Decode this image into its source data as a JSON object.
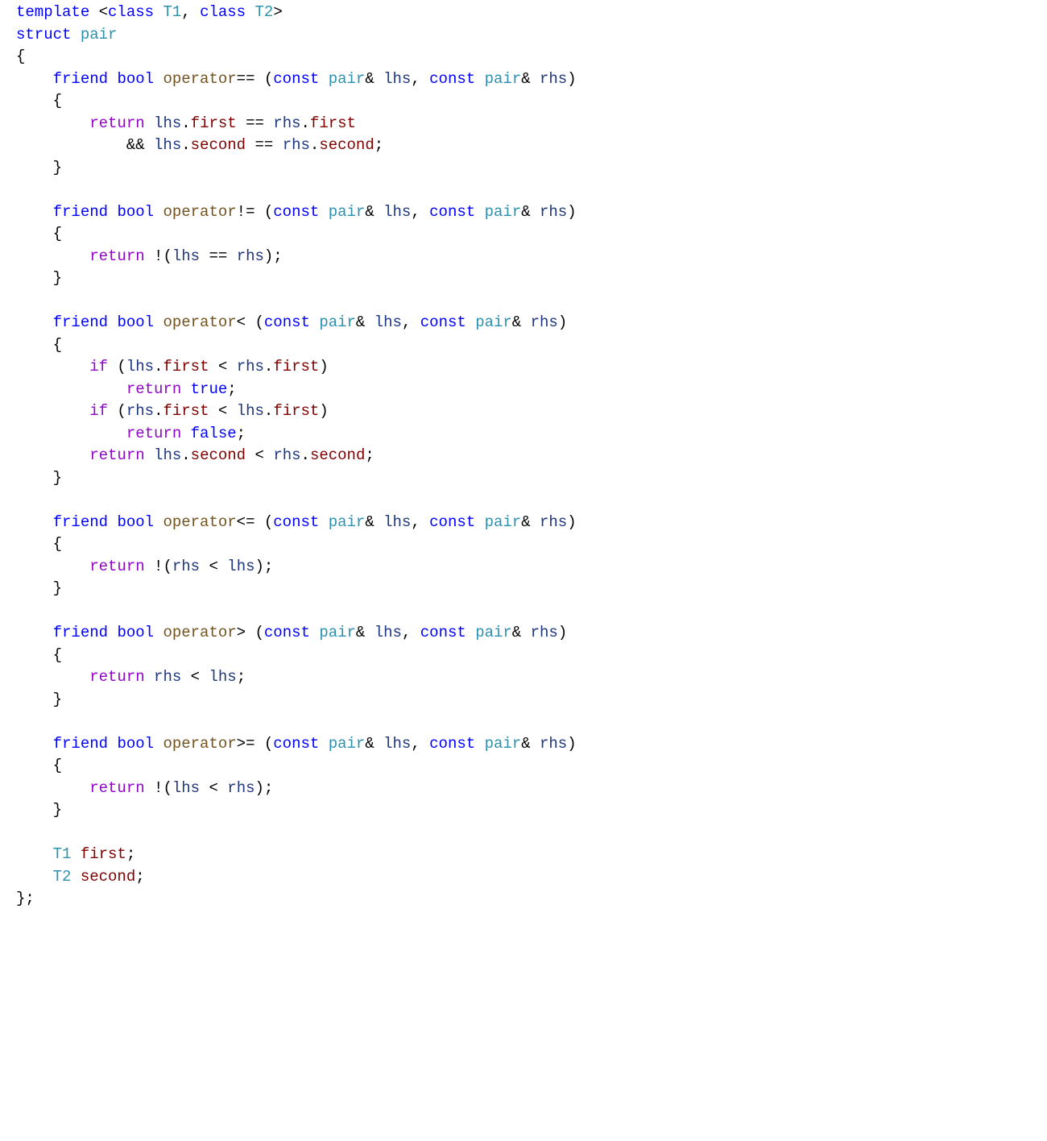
{
  "code": {
    "tokens": [
      [
        [
          "kw",
          "template"
        ],
        [
          "punc",
          " <"
        ],
        [
          "kw",
          "class"
        ],
        [
          "punc",
          " "
        ],
        [
          "type",
          "T1"
        ],
        [
          "punc",
          ", "
        ],
        [
          "kw",
          "class"
        ],
        [
          "punc",
          " "
        ],
        [
          "type",
          "T2"
        ],
        [
          "punc",
          ">"
        ]
      ],
      [
        [
          "kw",
          "struct"
        ],
        [
          "punc",
          " "
        ],
        [
          "type",
          "pair"
        ]
      ],
      [
        [
          "punc",
          "{"
        ]
      ],
      [
        [
          "punc",
          "    "
        ],
        [
          "kw",
          "friend"
        ],
        [
          "punc",
          " "
        ],
        [
          "kw",
          "bool"
        ],
        [
          "punc",
          " "
        ],
        [
          "func",
          "operator"
        ],
        [
          "punc",
          "== ("
        ],
        [
          "kw",
          "const"
        ],
        [
          "punc",
          " "
        ],
        [
          "type",
          "pair"
        ],
        [
          "punc",
          "& "
        ],
        [
          "var",
          "lhs"
        ],
        [
          "punc",
          ", "
        ],
        [
          "kw",
          "const"
        ],
        [
          "punc",
          " "
        ],
        [
          "type",
          "pair"
        ],
        [
          "punc",
          "& "
        ],
        [
          "var",
          "rhs"
        ],
        [
          "punc",
          ")"
        ]
      ],
      [
        [
          "punc",
          "    {"
        ]
      ],
      [
        [
          "punc",
          "        "
        ],
        [
          "ctrl",
          "return"
        ],
        [
          "punc",
          " "
        ],
        [
          "var",
          "lhs"
        ],
        [
          "punc",
          "."
        ],
        [
          "mem",
          "first"
        ],
        [
          "punc",
          " == "
        ],
        [
          "var",
          "rhs"
        ],
        [
          "punc",
          "."
        ],
        [
          "mem",
          "first"
        ]
      ],
      [
        [
          "punc",
          "            && "
        ],
        [
          "var",
          "lhs"
        ],
        [
          "punc",
          "."
        ],
        [
          "mem",
          "second"
        ],
        [
          "punc",
          " == "
        ],
        [
          "var",
          "rhs"
        ],
        [
          "punc",
          "."
        ],
        [
          "mem",
          "second"
        ],
        [
          "punc",
          ";"
        ]
      ],
      [
        [
          "punc",
          "    }"
        ]
      ],
      [
        [
          "punc",
          " "
        ]
      ],
      [
        [
          "punc",
          "    "
        ],
        [
          "kw",
          "friend"
        ],
        [
          "punc",
          " "
        ],
        [
          "kw",
          "bool"
        ],
        [
          "punc",
          " "
        ],
        [
          "func",
          "operator"
        ],
        [
          "punc",
          "!= ("
        ],
        [
          "kw",
          "const"
        ],
        [
          "punc",
          " "
        ],
        [
          "type",
          "pair"
        ],
        [
          "punc",
          "& "
        ],
        [
          "var",
          "lhs"
        ],
        [
          "punc",
          ", "
        ],
        [
          "kw",
          "const"
        ],
        [
          "punc",
          " "
        ],
        [
          "type",
          "pair"
        ],
        [
          "punc",
          "& "
        ],
        [
          "var",
          "rhs"
        ],
        [
          "punc",
          ")"
        ]
      ],
      [
        [
          "punc",
          "    {"
        ]
      ],
      [
        [
          "punc",
          "        "
        ],
        [
          "ctrl",
          "return"
        ],
        [
          "punc",
          " !("
        ],
        [
          "var",
          "lhs"
        ],
        [
          "punc",
          " == "
        ],
        [
          "var",
          "rhs"
        ],
        [
          "punc",
          ");"
        ]
      ],
      [
        [
          "punc",
          "    }"
        ]
      ],
      [
        [
          "punc",
          " "
        ]
      ],
      [
        [
          "punc",
          "    "
        ],
        [
          "kw",
          "friend"
        ],
        [
          "punc",
          " "
        ],
        [
          "kw",
          "bool"
        ],
        [
          "punc",
          " "
        ],
        [
          "func",
          "operator"
        ],
        [
          "punc",
          "< ("
        ],
        [
          "kw",
          "const"
        ],
        [
          "punc",
          " "
        ],
        [
          "type",
          "pair"
        ],
        [
          "punc",
          "& "
        ],
        [
          "var",
          "lhs"
        ],
        [
          "punc",
          ", "
        ],
        [
          "kw",
          "const"
        ],
        [
          "punc",
          " "
        ],
        [
          "type",
          "pair"
        ],
        [
          "punc",
          "& "
        ],
        [
          "var",
          "rhs"
        ],
        [
          "punc",
          ")"
        ]
      ],
      [
        [
          "punc",
          "    {"
        ]
      ],
      [
        [
          "punc",
          "        "
        ],
        [
          "ctrl",
          "if"
        ],
        [
          "punc",
          " ("
        ],
        [
          "var",
          "lhs"
        ],
        [
          "punc",
          "."
        ],
        [
          "mem",
          "first"
        ],
        [
          "punc",
          " < "
        ],
        [
          "var",
          "rhs"
        ],
        [
          "punc",
          "."
        ],
        [
          "mem",
          "first"
        ],
        [
          "punc",
          ")"
        ]
      ],
      [
        [
          "punc",
          "            "
        ],
        [
          "ctrl",
          "return"
        ],
        [
          "punc",
          " "
        ],
        [
          "kw",
          "true"
        ],
        [
          "punc",
          ";"
        ]
      ],
      [
        [
          "punc",
          "        "
        ],
        [
          "ctrl",
          "if"
        ],
        [
          "punc",
          " ("
        ],
        [
          "var",
          "rhs"
        ],
        [
          "punc",
          "."
        ],
        [
          "mem",
          "first"
        ],
        [
          "punc",
          " < "
        ],
        [
          "var",
          "lhs"
        ],
        [
          "punc",
          "."
        ],
        [
          "mem",
          "first"
        ],
        [
          "punc",
          ")"
        ]
      ],
      [
        [
          "punc",
          "            "
        ],
        [
          "ctrl",
          "return"
        ],
        [
          "punc",
          " "
        ],
        [
          "kw",
          "false"
        ],
        [
          "punc",
          ";"
        ]
      ],
      [
        [
          "punc",
          "        "
        ],
        [
          "ctrl",
          "return"
        ],
        [
          "punc",
          " "
        ],
        [
          "var",
          "lhs"
        ],
        [
          "punc",
          "."
        ],
        [
          "mem",
          "second"
        ],
        [
          "punc",
          " < "
        ],
        [
          "var",
          "rhs"
        ],
        [
          "punc",
          "."
        ],
        [
          "mem",
          "second"
        ],
        [
          "punc",
          ";"
        ]
      ],
      [
        [
          "punc",
          "    }"
        ]
      ],
      [
        [
          "punc",
          " "
        ]
      ],
      [
        [
          "punc",
          "    "
        ],
        [
          "kw",
          "friend"
        ],
        [
          "punc",
          " "
        ],
        [
          "kw",
          "bool"
        ],
        [
          "punc",
          " "
        ],
        [
          "func",
          "operator"
        ],
        [
          "punc",
          "<= ("
        ],
        [
          "kw",
          "const"
        ],
        [
          "punc",
          " "
        ],
        [
          "type",
          "pair"
        ],
        [
          "punc",
          "& "
        ],
        [
          "var",
          "lhs"
        ],
        [
          "punc",
          ", "
        ],
        [
          "kw",
          "const"
        ],
        [
          "punc",
          " "
        ],
        [
          "type",
          "pair"
        ],
        [
          "punc",
          "& "
        ],
        [
          "var",
          "rhs"
        ],
        [
          "punc",
          ")"
        ]
      ],
      [
        [
          "punc",
          "    {"
        ]
      ],
      [
        [
          "punc",
          "        "
        ],
        [
          "ctrl",
          "return"
        ],
        [
          "punc",
          " !("
        ],
        [
          "var",
          "rhs"
        ],
        [
          "punc",
          " < "
        ],
        [
          "var",
          "lhs"
        ],
        [
          "punc",
          ");"
        ]
      ],
      [
        [
          "punc",
          "    }"
        ]
      ],
      [
        [
          "punc",
          " "
        ]
      ],
      [
        [
          "punc",
          "    "
        ],
        [
          "kw",
          "friend"
        ],
        [
          "punc",
          " "
        ],
        [
          "kw",
          "bool"
        ],
        [
          "punc",
          " "
        ],
        [
          "func",
          "operator"
        ],
        [
          "punc",
          "> ("
        ],
        [
          "kw",
          "const"
        ],
        [
          "punc",
          " "
        ],
        [
          "type",
          "pair"
        ],
        [
          "punc",
          "& "
        ],
        [
          "var",
          "lhs"
        ],
        [
          "punc",
          ", "
        ],
        [
          "kw",
          "const"
        ],
        [
          "punc",
          " "
        ],
        [
          "type",
          "pair"
        ],
        [
          "punc",
          "& "
        ],
        [
          "var",
          "rhs"
        ],
        [
          "punc",
          ")"
        ]
      ],
      [
        [
          "punc",
          "    {"
        ]
      ],
      [
        [
          "punc",
          "        "
        ],
        [
          "ctrl",
          "return"
        ],
        [
          "punc",
          " "
        ],
        [
          "var",
          "rhs"
        ],
        [
          "punc",
          " < "
        ],
        [
          "var",
          "lhs"
        ],
        [
          "punc",
          ";"
        ]
      ],
      [
        [
          "punc",
          "    }"
        ]
      ],
      [
        [
          "punc",
          " "
        ]
      ],
      [
        [
          "punc",
          "    "
        ],
        [
          "kw",
          "friend"
        ],
        [
          "punc",
          " "
        ],
        [
          "kw",
          "bool"
        ],
        [
          "punc",
          " "
        ],
        [
          "func",
          "operator"
        ],
        [
          "punc",
          ">= ("
        ],
        [
          "kw",
          "const"
        ],
        [
          "punc",
          " "
        ],
        [
          "type",
          "pair"
        ],
        [
          "punc",
          "& "
        ],
        [
          "var",
          "lhs"
        ],
        [
          "punc",
          ", "
        ],
        [
          "kw",
          "const"
        ],
        [
          "punc",
          " "
        ],
        [
          "type",
          "pair"
        ],
        [
          "punc",
          "& "
        ],
        [
          "var",
          "rhs"
        ],
        [
          "punc",
          ")"
        ]
      ],
      [
        [
          "punc",
          "    {"
        ]
      ],
      [
        [
          "punc",
          "        "
        ],
        [
          "ctrl",
          "return"
        ],
        [
          "punc",
          " !("
        ],
        [
          "var",
          "lhs"
        ],
        [
          "punc",
          " < "
        ],
        [
          "var",
          "rhs"
        ],
        [
          "punc",
          ");"
        ]
      ],
      [
        [
          "punc",
          "    }"
        ]
      ],
      [
        [
          "punc",
          " "
        ]
      ],
      [
        [
          "punc",
          "    "
        ],
        [
          "type",
          "T1"
        ],
        [
          "punc",
          " "
        ],
        [
          "mem",
          "first"
        ],
        [
          "punc",
          ";"
        ]
      ],
      [
        [
          "punc",
          "    "
        ],
        [
          "type",
          "T2"
        ],
        [
          "punc",
          " "
        ],
        [
          "mem",
          "second"
        ],
        [
          "punc",
          ";"
        ]
      ],
      [
        [
          "punc",
          "};"
        ]
      ]
    ]
  }
}
